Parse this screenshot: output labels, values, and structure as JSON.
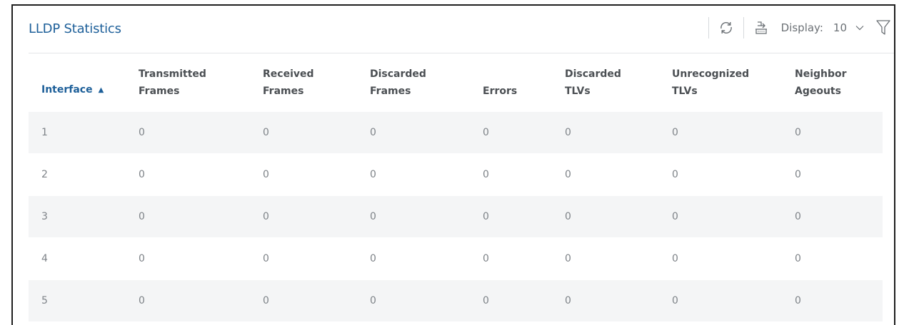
{
  "panel": {
    "title": "LLDP Statistics"
  },
  "toolbar": {
    "refresh_icon": "refresh-icon",
    "export_icon": "export-icon",
    "display_label": "Display:",
    "display_value": "10",
    "filter_icon": "filter-icon"
  },
  "table": {
    "columns": [
      {
        "line1": "Interface",
        "line2": "",
        "sorted": "ascending"
      },
      {
        "line1": "Transmitted",
        "line2": "Frames"
      },
      {
        "line1": "Received",
        "line2": "Frames"
      },
      {
        "line1": "Discarded",
        "line2": "Frames"
      },
      {
        "line1": "",
        "line2": "Errors"
      },
      {
        "line1": "Discarded",
        "line2": "TLVs"
      },
      {
        "line1": "Unrecognized",
        "line2": "TLVs"
      },
      {
        "line1": "Neighbor",
        "line2": "Ageouts"
      }
    ],
    "rows": [
      [
        "1",
        "0",
        "0",
        "0",
        "0",
        "0",
        "0",
        "0"
      ],
      [
        "2",
        "0",
        "0",
        "0",
        "0",
        "0",
        "0",
        "0"
      ],
      [
        "3",
        "0",
        "0",
        "0",
        "0",
        "0",
        "0",
        "0"
      ],
      [
        "4",
        "0",
        "0",
        "0",
        "0",
        "0",
        "0",
        "0"
      ],
      [
        "5",
        "0",
        "0",
        "0",
        "0",
        "0",
        "0",
        "0"
      ]
    ]
  },
  "colors": {
    "accent": "#1d5f99",
    "header_text": "#4b4f53",
    "cell_text": "#7e8388",
    "stripe": "#f4f5f6"
  }
}
